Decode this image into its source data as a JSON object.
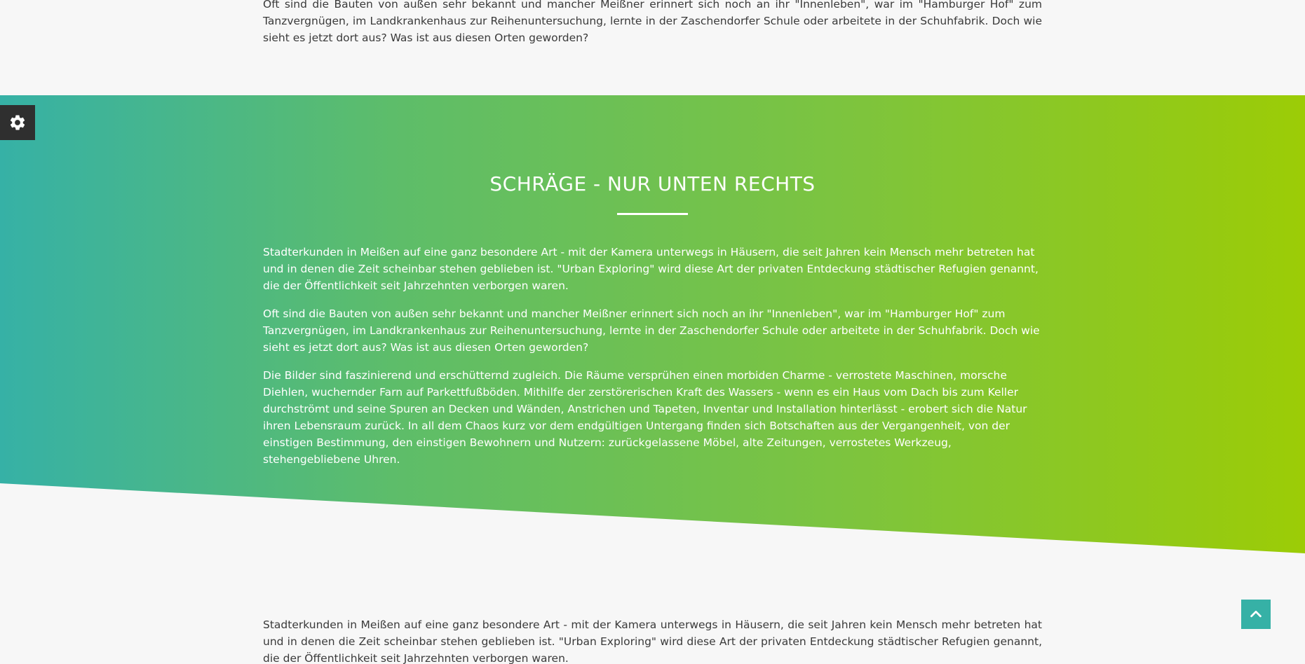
{
  "top_section": {
    "paragraph": "Oft sind die Bauten von außen sehr bekannt und mancher Meißner erinnert sich noch an ihr \"Innenleben\", war im \"Hamburger Hof\" zum Tanzvergnügen, im Landkrankenhaus zur Reihenuntersuchung, lernte in der Zaschendorfer Schule oder arbeitete in der Schuhfabrik. Doch wie sieht es jetzt dort aus? Was ist aus diesen Orten geworden?"
  },
  "slant_section": {
    "title": "SCHRÄGE - NUR UNTEN RECHTS",
    "paragraphs": [
      "Stadterkunden in Meißen auf eine ganz besondere Art - mit der Kamera unterwegs in Häusern, die seit Jahren kein Mensch mehr betreten hat und in denen die Zeit scheinbar stehen geblieben ist. \"Urban Exploring\" wird diese Art der privaten Entdeckung städtischer Refugien genannt, die der Öffentlichkeit seit Jahrzehnten verborgen waren.",
      "Oft sind die Bauten von außen sehr bekannt und mancher Meißner erinnert sich noch an ihr \"Innenleben\", war im \"Hamburger Hof\" zum Tanzvergnügen, im Landkrankenhaus zur Reihenuntersuchung, lernte in der Zaschendorfer Schule oder arbeitete in der Schuhfabrik. Doch wie sieht es jetzt dort aus? Was ist aus diesen Orten geworden?",
      "Die Bilder sind faszinierend und erschütternd zugleich. Die Räume versprühen einen morbiden Charme - verrostete Maschinen, morsche Diehlen, wuchernder Farn auf Parkettfußböden. Mithilfe der zerstörerischen Kraft des Wassers - wenn es ein Haus vom Dach bis zum Keller durchströmt und seine Spuren an Decken und Wänden, Anstrichen und Tapeten, Inventar und Installation hinterlässt - erobert sich die Natur ihren Lebensraum zurück. In all dem Chaos kurz vor dem endgültigen Untergang finden sich Botschaften aus der Vergangenheit, von der einstigen Bestimmung, den einstigen Bewohnern und Nutzern: zurückgelassene Möbel, alte Zeitungen, verrostetes Werkzeug, stehengebliebene Uhren."
    ]
  },
  "bottom_section": {
    "paragraph": "Stadterkunden in Meißen auf eine ganz besondere Art - mit der Kamera unterwegs in Häusern, die seit Jahren kein Mensch mehr betreten hat und in denen die Zeit scheinbar stehen geblieben ist. \"Urban Exploring\" wird diese Art der privaten Entdeckung städtischer Refugien genannt, die der Öffentlichkeit seit Jahrzehnten verborgen waren."
  },
  "controls": {
    "settings_icon": "gear-icon",
    "scroll_top_icon": "chevron-up-icon"
  },
  "colors": {
    "gradient_start": "#36b1a6",
    "gradient_end": "#9ccc06",
    "accent": "#36b1a6",
    "settings_bg": "#2f2f2f"
  }
}
